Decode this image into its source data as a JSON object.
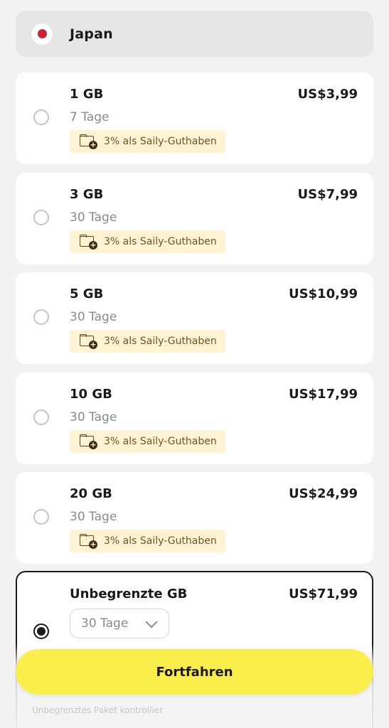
{
  "country": {
    "name": "Japan",
    "flag_color": "#d0212e"
  },
  "plans": [
    {
      "gb": "1 GB",
      "price": "US$3,99",
      "days": "7 Tage",
      "badge": "3% als Saily-Guthaben"
    },
    {
      "gb": "3 GB",
      "price": "US$7,99",
      "days": "30 Tage",
      "badge": "3% als Saily-Guthaben"
    },
    {
      "gb": "5 GB",
      "price": "US$10,99",
      "days": "30 Tage",
      "badge": "3% als Saily-Guthaben"
    },
    {
      "gb": "10 GB",
      "price": "US$17,99",
      "days": "30 Tage",
      "badge": "3% als Saily-Guthaben"
    },
    {
      "gb": "20 GB",
      "price": "US$24,99",
      "days": "30 Tage",
      "badge": "3% als Saily-Guthaben"
    }
  ],
  "selected_plan": {
    "gb": "Unbegrenzte GB",
    "price": "US$71,99",
    "duration_value": "30 Tage",
    "hint": "Unbegrenztes Paket kontrollier"
  },
  "cta": {
    "label": "Fortfahren",
    "color": "#faee4a"
  }
}
